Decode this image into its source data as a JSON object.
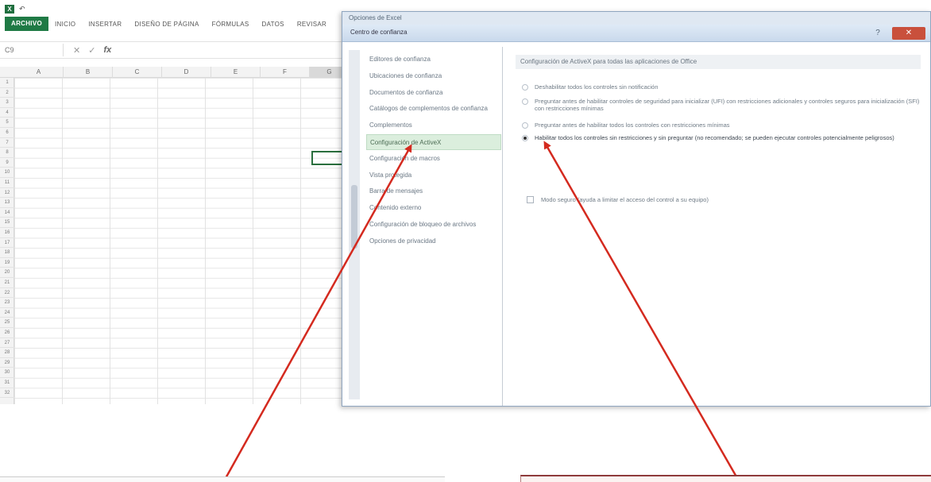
{
  "excel": {
    "qat": {
      "logo": "X",
      "undo": "↶"
    },
    "ribbon_tabs": [
      "ARCHIVO",
      "INICIO",
      "INSERTAR",
      "DISEÑO DE PÁGINA",
      "FÓRMULAS",
      "DATOS",
      "REVISAR"
    ],
    "formula_bar": {
      "name_box": "C9",
      "cancel": "✕",
      "enter": "✓",
      "fx": "fx"
    },
    "columns": [
      "A",
      "B",
      "C",
      "D",
      "E",
      "F",
      "G"
    ],
    "rows": [
      "1",
      "2",
      "3",
      "4",
      "5",
      "6",
      "7",
      "8",
      "9",
      "10",
      "11",
      "12",
      "13",
      "14",
      "15",
      "16",
      "17",
      "18",
      "19",
      "20",
      "21",
      "22",
      "23",
      "24",
      "25",
      "26",
      "27",
      "28",
      "29",
      "30",
      "31",
      "32"
    ]
  },
  "dialog": {
    "outer_title": "Opciones de Excel",
    "title": "Centro de confianza",
    "help": "?",
    "close": "✕",
    "nav_items": [
      "Editores de confianza",
      "Ubicaciones de confianza",
      "Documentos de confianza",
      "Catálogos de complementos de confianza",
      "Complementos",
      "Configuración de ActiveX",
      "Configuración de macros",
      "Vista protegida",
      "Barra de mensajes",
      "Contenido externo",
      "Configuración de bloqueo de archivos",
      "Opciones de privacidad"
    ],
    "selected_nav_index": 5,
    "section_header": "Configuración de ActiveX para todas las aplicaciones de Office",
    "options": [
      {
        "label": "Deshabilitar todos los controles sin notificación",
        "selected": false
      },
      {
        "label": "Preguntar antes de habilitar controles de seguridad para inicializar (UFI) con restricciones adicionales y controles seguros para inicialización (SFI) con restricciones mínimas",
        "selected": false
      },
      {
        "label": "Preguntar antes de habilitar todos los controles con restricciones mínimas",
        "selected": false
      },
      {
        "label": "Habilitar todos los controles sin restricciones y sin preguntar (no recomendado; se pueden ejecutar controles potencialmente peligrosos)",
        "selected": true
      }
    ],
    "safe_mode": "Modo seguro (ayuda a limitar el acceso del control a su equipo)"
  },
  "colors": {
    "excel_green": "#1f7a45",
    "nav_selected": "#dbeedd",
    "arrow_red": "#d42a1f"
  }
}
